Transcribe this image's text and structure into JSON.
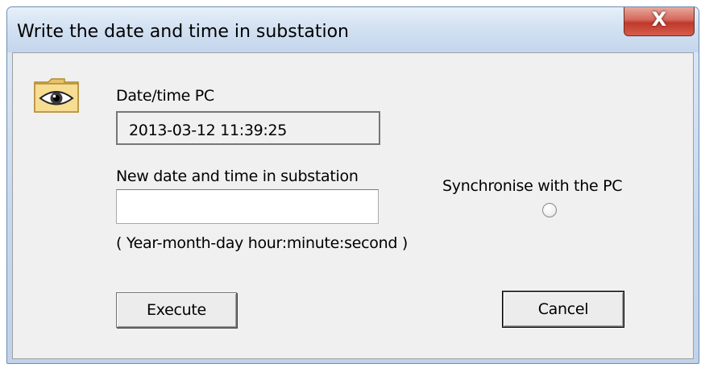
{
  "dialog": {
    "title": "Write the date and time in substation",
    "close_glyph": "X"
  },
  "icon": {
    "name": "eye-folder-icon"
  },
  "pc_time": {
    "label": "Date/time PC",
    "value": "2013-03-12  11:39:25"
  },
  "new_time": {
    "label": "New date and time in substation",
    "value": "",
    "format_hint": "( Year-month-day hour:minute:second )"
  },
  "sync": {
    "label": "Synchronise with the PC",
    "checked": false
  },
  "buttons": {
    "execute": "Execute",
    "cancel": "Cancel"
  },
  "colors": {
    "title_bar": "#d3e1f2",
    "client_bg": "#f0f0f0",
    "close_button": "#c0392b",
    "folder": "#f2d785"
  }
}
